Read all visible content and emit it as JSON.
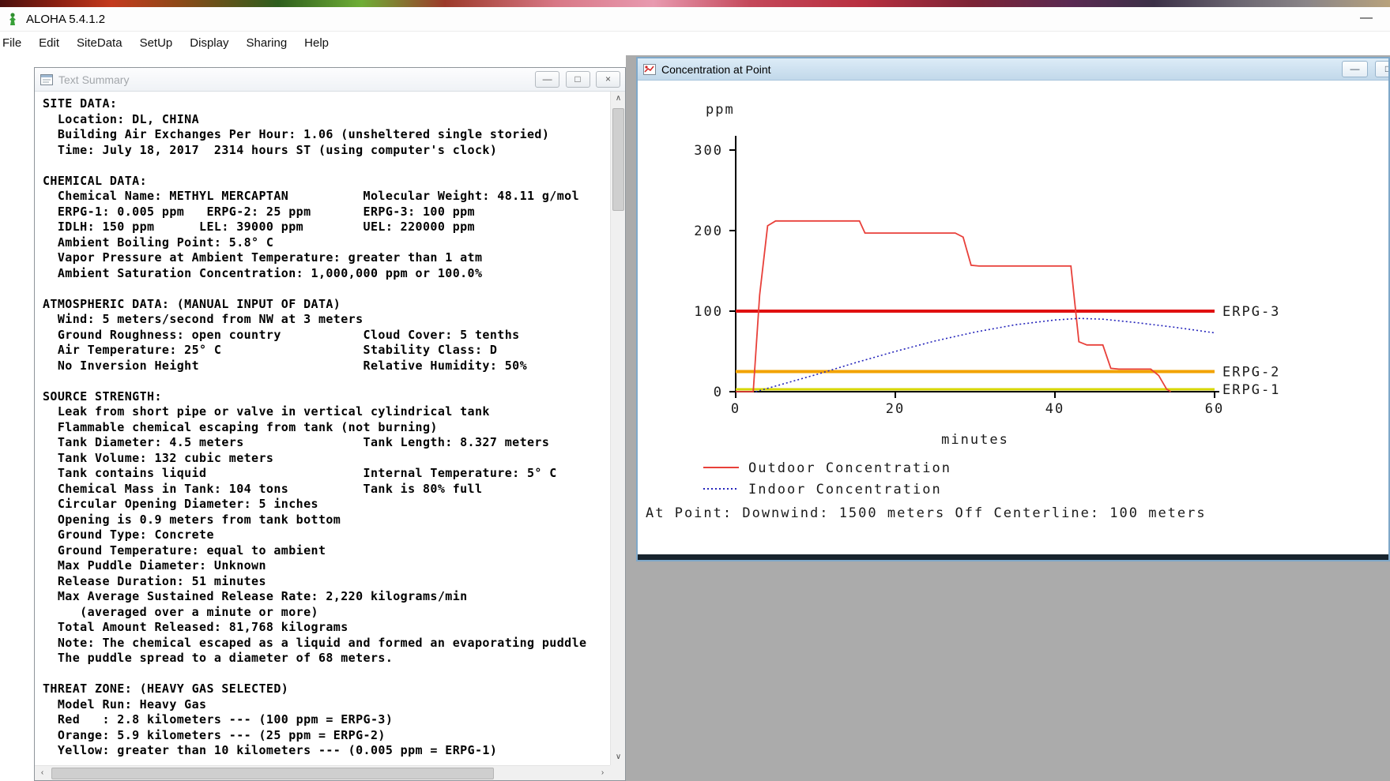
{
  "app": {
    "title": "ALOHA 5.4.1.2",
    "minimize_glyph": "—",
    "menu": [
      "File",
      "Edit",
      "SiteData",
      "SetUp",
      "Display",
      "Sharing",
      "Help"
    ]
  },
  "text_summary": {
    "title": "Text Summary",
    "controls": {
      "minimize": "—",
      "restore": "□",
      "close": "×"
    },
    "scrollbar": {
      "up": "∧",
      "down": "∨",
      "left": "‹",
      "right": "›"
    },
    "lines": [
      "SITE DATA:",
      "  Location: DL, CHINA",
      "  Building Air Exchanges Per Hour: 1.06 (unsheltered single storied)",
      "  Time: July 18, 2017  2314 hours ST (using computer's clock)",
      "",
      "CHEMICAL DATA:",
      "  Chemical Name: METHYL MERCAPTAN          Molecular Weight: 48.11 g/mol",
      "  ERPG-1: 0.005 ppm   ERPG-2: 25 ppm       ERPG-3: 100 ppm",
      "  IDLH: 150 ppm      LEL: 39000 ppm        UEL: 220000 ppm",
      "  Ambient Boiling Point: 5.8° C",
      "  Vapor Pressure at Ambient Temperature: greater than 1 atm",
      "  Ambient Saturation Concentration: 1,000,000 ppm or 100.0%",
      "",
      "ATMOSPHERIC DATA: (MANUAL INPUT OF DATA)",
      "  Wind: 5 meters/second from NW at 3 meters",
      "  Ground Roughness: open country           Cloud Cover: 5 tenths",
      "  Air Temperature: 25° C                   Stability Class: D",
      "  No Inversion Height                      Relative Humidity: 50%",
      "",
      "SOURCE STRENGTH:",
      "  Leak from short pipe or valve in vertical cylindrical tank",
      "  Flammable chemical escaping from tank (not burning)",
      "  Tank Diameter: 4.5 meters                Tank Length: 8.327 meters",
      "  Tank Volume: 132 cubic meters",
      "  Tank contains liquid                     Internal Temperature: 5° C",
      "  Chemical Mass in Tank: 104 tons          Tank is 80% full",
      "  Circular Opening Diameter: 5 inches",
      "  Opening is 0.9 meters from tank bottom",
      "  Ground Type: Concrete",
      "  Ground Temperature: equal to ambient",
      "  Max Puddle Diameter: Unknown",
      "  Release Duration: 51 minutes",
      "  Max Average Sustained Release Rate: 2,220 kilograms/min",
      "     (averaged over a minute or more)",
      "  Total Amount Released: 81,768 kilograms",
      "  Note: The chemical escaped as a liquid and formed an evaporating puddle",
      "  The puddle spread to a diameter of 68 meters.",
      "",
      "THREAT ZONE: (HEAVY GAS SELECTED)",
      "  Model Run: Heavy Gas",
      "  Red   : 2.8 kilometers --- (100 ppm = ERPG-3)",
      "  Orange: 5.9 kilometers --- (25 ppm = ERPG-2)",
      "  Yellow: greater than 10 kilometers --- (0.005 ppm = ERPG-1)"
    ]
  },
  "concentration": {
    "title": "Concentration at Point",
    "controls": {
      "minimize": "—",
      "maximize": "□"
    }
  },
  "chart_data": {
    "type": "line",
    "title": "",
    "ylabel": "ppm",
    "xlabel": "minutes",
    "xlim": [
      0,
      60
    ],
    "ylim": [
      0,
      300
    ],
    "xticks": [
      0,
      20,
      40,
      60
    ],
    "yticks": [
      0,
      100,
      200,
      300
    ],
    "grid": false,
    "legend_position": "bottom-left",
    "series": [
      {
        "name": "Outdoor Concentration",
        "color": "#e8403a",
        "style": "solid",
        "points": [
          [
            0,
            0
          ],
          [
            2.2,
            0
          ],
          [
            3,
            120
          ],
          [
            4,
            206
          ],
          [
            5,
            212
          ],
          [
            15.5,
            212
          ],
          [
            16.2,
            197
          ],
          [
            27.5,
            197
          ],
          [
            28.5,
            192
          ],
          [
            29.5,
            157
          ],
          [
            30.5,
            156
          ],
          [
            42,
            156
          ],
          [
            43,
            62
          ],
          [
            44,
            58
          ],
          [
            46,
            58
          ],
          [
            47,
            29
          ],
          [
            48,
            28
          ],
          [
            52,
            28
          ],
          [
            53,
            20
          ],
          [
            54,
            3
          ],
          [
            54.5,
            0
          ]
        ]
      },
      {
        "name": "Indoor Concentration",
        "color": "#2424bb",
        "style": "dotted",
        "points": [
          [
            2.5,
            0
          ],
          [
            5,
            7
          ],
          [
            10,
            21
          ],
          [
            15,
            36
          ],
          [
            20,
            50
          ],
          [
            25,
            63
          ],
          [
            30,
            74
          ],
          [
            35,
            83
          ],
          [
            40,
            89
          ],
          [
            43,
            91
          ],
          [
            46,
            90
          ],
          [
            50,
            86
          ],
          [
            55,
            80
          ],
          [
            60,
            73
          ]
        ]
      }
    ],
    "thresholds": [
      {
        "label": "ERPG-3",
        "value": 100,
        "color": "#e01010",
        "stroke_width": 4
      },
      {
        "label": "ERPG-2",
        "value": 25,
        "color": "#f2a300",
        "stroke_width": 4
      },
      {
        "label": "ERPG-1",
        "value": 0.005,
        "display_value": 3,
        "color": "#d6d600",
        "stroke_width": 3
      }
    ],
    "annotation": "At Point:      Downwind: 1500 meters       Off Centerline: 100 meters"
  },
  "colors": {
    "mdi_background": "#ababab",
    "active_titlebar": "#c9dcec",
    "erpg3_red": "#e01010",
    "erpg2_orange": "#f2a300",
    "erpg1_yellow": "#d6d600",
    "outdoor_red": "#e8403a",
    "indoor_blue": "#2424bb"
  }
}
